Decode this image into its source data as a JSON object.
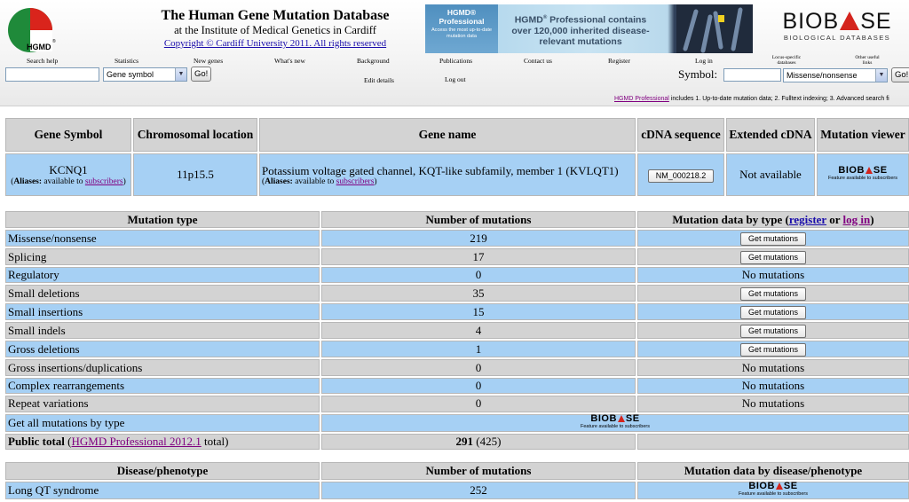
{
  "header": {
    "logo_text": "HGMD",
    "title": "The Human Gene Mutation Database",
    "subtitle": "at the Institute of Medical Genetics in Cardiff",
    "copyright": "Copyright © Cardiff University 2011. All rights reserved",
    "promo": {
      "left_title": "HGMD®\nProfessional",
      "left_text": "Access the most up-to-date mutation data",
      "main_text_1": "HGMD",
      "main_text_2": " Professional contains over 120,000 inherited disease-relevant mutations"
    },
    "biobase": {
      "word_left": "BIOB",
      "word_right": "SE",
      "tagline": "BIOLOGICAL DATABASES"
    }
  },
  "nav": {
    "search_help": "Search help",
    "statistics": "Statistics",
    "new_genes": "New genes",
    "whats_new": "What's new",
    "background": "Background",
    "publications": "Publications",
    "contact_us": "Contact us",
    "register": "Register",
    "log_in": "Log in",
    "locus_specific": "Locus-specific databases",
    "other_links": "Other useful links",
    "edit_details": "Edit details",
    "log_out": "Log out"
  },
  "search": {
    "value": "",
    "type_selected": "Gene symbol",
    "go_label": "Go!"
  },
  "symbol_search": {
    "label": "Symbol:",
    "value": "",
    "type_selected": "Missense/nonsense",
    "go_label": "Go!"
  },
  "pro_note": {
    "link": "HGMD Professional",
    "text": " includes 1. Up-to-date mutation data; 2. Fulltext indexing; 3. Advanced search fi"
  },
  "gene": {
    "headers": [
      "Gene Symbol",
      "Chromosomal location",
      "Gene name",
      "cDNA sequence",
      "Extended cDNA",
      "Mutation viewer"
    ],
    "symbol": "KCNQ1",
    "aliases_label": "Aliases:",
    "aliases_text": " available to ",
    "aliases_link": "subscribers",
    "location": "11p15.5",
    "name": "Potassium voltage gated channel, KQT-like subfamily, member 1 (KVLQT1)",
    "cdna": "NM_000218.2",
    "extended_cdna": "Not available",
    "biobase_feature_text": "Feature available to subscribers"
  },
  "mutations": {
    "headers": {
      "type": "Mutation type",
      "count": "Number of mutations",
      "data": "Mutation data by type (",
      "register": "register",
      "or": " or ",
      "login": "log in",
      "close": ")"
    },
    "get_label": "Get mutations",
    "none_label": "No mutations",
    "rows": [
      {
        "type": "Missense/nonsense",
        "count": "219",
        "action": "Get mutations"
      },
      {
        "type": "Splicing",
        "count": "17",
        "action": "Get mutations"
      },
      {
        "type": "Regulatory",
        "count": "0",
        "action": "No mutations"
      },
      {
        "type": "Small deletions",
        "count": "35",
        "action": "Get mutations"
      },
      {
        "type": "Small insertions",
        "count": "15",
        "action": "Get mutations"
      },
      {
        "type": "Small indels",
        "count": "4",
        "action": "Get mutations"
      },
      {
        "type": "Gross deletions",
        "count": "1",
        "action": "Get mutations"
      },
      {
        "type": "Gross insertions/duplications",
        "count": "0",
        "action": "No mutations"
      },
      {
        "type": "Complex rearrangements",
        "count": "0",
        "action": "No mutations"
      },
      {
        "type": "Repeat variations",
        "count": "0",
        "action": "No mutations"
      }
    ],
    "get_all_label": "Get all mutations by type",
    "total_label": "Public total",
    "total_link": "HGMD Professional 2012.1",
    "total_suffix": " total)",
    "total_open": " (",
    "total_count": "291",
    "total_pro": " (425)"
  },
  "disease": {
    "headers": [
      "Disease/phenotype",
      "Number of mutations",
      "Mutation data by disease/phenotype"
    ],
    "rows": [
      {
        "name": "Long QT syndrome",
        "count": "252"
      }
    ]
  }
}
